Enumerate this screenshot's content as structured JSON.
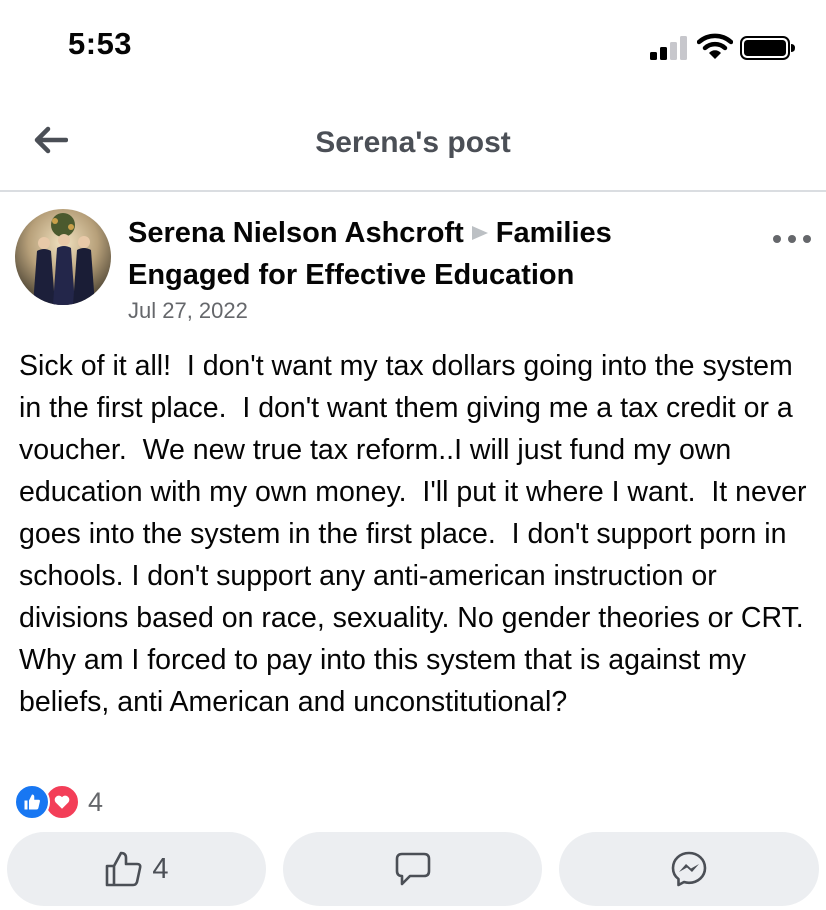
{
  "status_bar": {
    "time": "5:53",
    "icons": [
      "signal-icon",
      "wifi-icon",
      "battery-icon"
    ]
  },
  "header": {
    "title": "Serena's post",
    "back_icon": "arrow-left-icon"
  },
  "post": {
    "author": "Serena Nielson Ashcroft",
    "group": "Families Engaged for Effective Education",
    "date": "Jul 27, 2022",
    "text": "Sick of it all!  I don't want my tax dollars going into the system in the first place.  I don't want them giving me a tax credit or a voucher.  We new true tax reform..I will just fund my own education with my own money.  I'll put it where I want.  It never goes into the system in the first place.  I don't support porn in schools. I don't support any anti-american instruction or divisions based on race, sexuality. No gender theories or CRT.  Why am I forced to pay into this system that is against my beliefs, anti American and unconstitutional?",
    "reaction_count": "4",
    "reaction_icons": [
      "like-icon",
      "love-icon"
    ]
  },
  "actions": {
    "like_count": "4",
    "like_icon": "thumbs-up-icon",
    "comment_icon": "comment-icon",
    "share_icon": "messenger-icon"
  },
  "colors": {
    "like_blue": "#1877f2",
    "love_red": "#f33e58",
    "secondary_text": "#65676b",
    "button_bg": "#eceef1"
  }
}
